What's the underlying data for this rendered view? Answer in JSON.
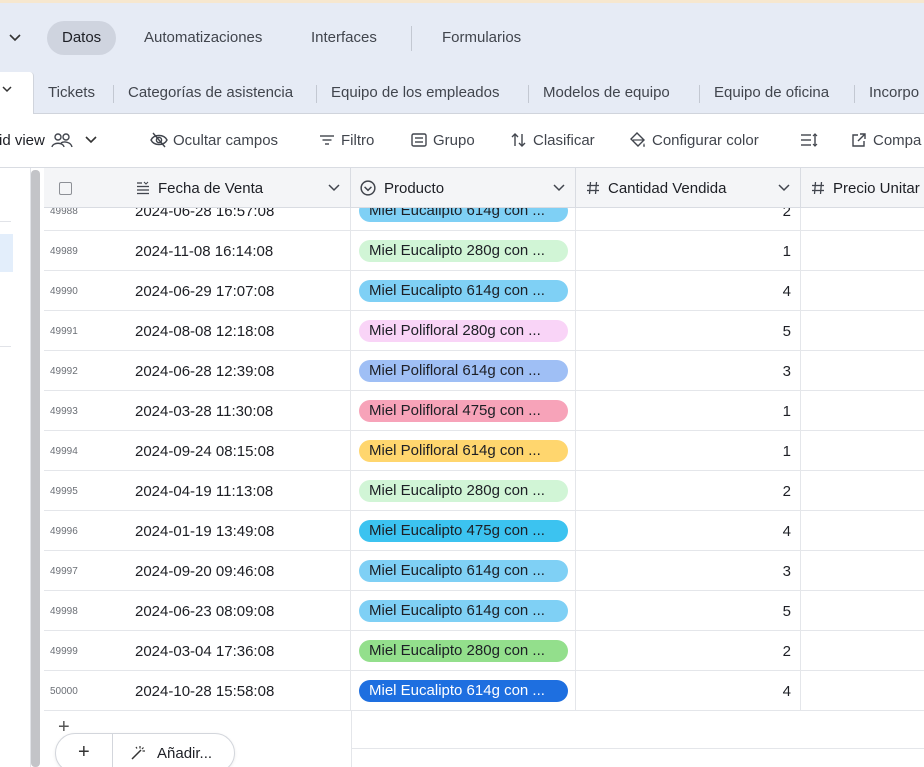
{
  "topnav": {
    "items": [
      {
        "label": "Datos",
        "active": true
      },
      {
        "label": "Automatizaciones"
      },
      {
        "label": "Interfaces"
      },
      {
        "label": "Formularios"
      }
    ]
  },
  "tabs": [
    "Tickets",
    "Categorías de asistencia",
    "Equipo de los empleados",
    "Modelos de equipo",
    "Equipo de oficina",
    "Incorpo"
  ],
  "toolbar": {
    "view_name": "rid view",
    "hide_fields": "Ocultar campos",
    "filter": "Filtro",
    "group": "Grupo",
    "sort": "Clasificar",
    "color": "Configurar color",
    "share": "Compa"
  },
  "columns": {
    "date": "Fecha de Venta",
    "product": "Producto",
    "qty": "Cantidad Vendida",
    "price": "Precio Unitar"
  },
  "rows": [
    {
      "id": "49988",
      "date": "2024-06-28 16:57:08",
      "product": "Miel Eucalipto 614g con ...",
      "color": "#7fd0f5",
      "qty": "2"
    },
    {
      "id": "49989",
      "date": "2024-11-08 16:14:08",
      "product": "Miel Eucalipto 280g con ...",
      "color": "#d1f5d6",
      "qty": "1"
    },
    {
      "id": "49990",
      "date": "2024-06-29 17:07:08",
      "product": "Miel Eucalipto 614g con ...",
      "color": "#7fd0f5",
      "qty": "4"
    },
    {
      "id": "49991",
      "date": "2024-08-08 12:18:08",
      "product": "Miel Polifloral 280g con ...",
      "color": "#f9d4f7",
      "qty": "5"
    },
    {
      "id": "49992",
      "date": "2024-06-28 12:39:08",
      "product": "Miel Polifloral 614g con ...",
      "color": "#9fbff5",
      "qty": "3"
    },
    {
      "id": "49993",
      "date": "2024-03-28 11:30:08",
      "product": "Miel Polifloral 475g con ...",
      "color": "#f7a3b9",
      "qty": "1"
    },
    {
      "id": "49994",
      "date": "2024-09-24 08:15:08",
      "product": "Miel Polifloral 614g con ...",
      "color": "#ffd66e",
      "qty": "1"
    },
    {
      "id": "49995",
      "date": "2024-04-19 11:13:08",
      "product": "Miel Eucalipto 280g con ...",
      "color": "#d1f5d6",
      "qty": "2"
    },
    {
      "id": "49996",
      "date": "2024-01-19 13:49:08",
      "product": "Miel Eucalipto 475g con ...",
      "color": "#3cc3f0",
      "qty": "4"
    },
    {
      "id": "49997",
      "date": "2024-09-20 09:46:08",
      "product": "Miel Eucalipto 614g con ...",
      "color": "#7fd0f5",
      "qty": "3"
    },
    {
      "id": "49998",
      "date": "2024-06-23 08:09:08",
      "product": "Miel Eucalipto 614g con ...",
      "color": "#7fd0f5",
      "qty": "5"
    },
    {
      "id": "49999",
      "date": "2024-03-04 17:36:08",
      "product": "Miel Eucalipto 280g con ...",
      "color": "#93df8c",
      "qty": "2"
    },
    {
      "id": "50000",
      "date": "2024-10-28 15:58:08",
      "product": "Miel Eucalipto 614g con ...",
      "color": "#1e6fe0",
      "text_color": "#ffffff",
      "qty": "4"
    }
  ],
  "add_bar": {
    "label": "Añadir..."
  }
}
